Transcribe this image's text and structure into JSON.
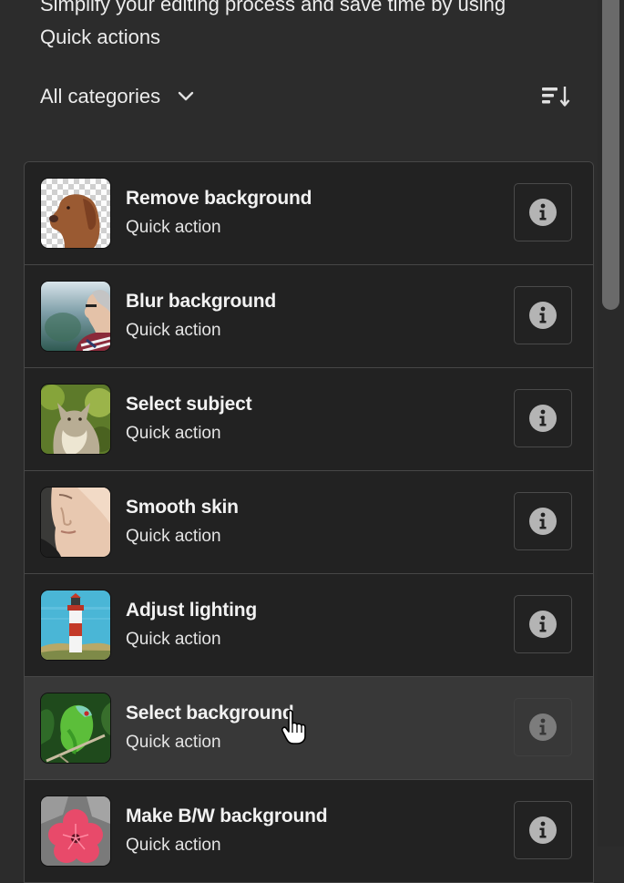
{
  "intro": {
    "line1": "Simplify your editing process and save time by using",
    "line2": "Quick actions"
  },
  "filter": {
    "category_label": "All categories",
    "chevron_icon": "chevron-down-icon",
    "sort_icon": "sort-descending-icon"
  },
  "actions": [
    {
      "title": "Remove background",
      "subtitle": "Quick action",
      "thumbnail": "dog-transparent-background",
      "info_icon": "info-icon"
    },
    {
      "title": "Blur background",
      "subtitle": "Quick action",
      "thumbnail": "woman-profile-blurred",
      "info_icon": "info-icon"
    },
    {
      "title": "Select subject",
      "subtitle": "Quick action",
      "thumbnail": "cat-in-grass",
      "info_icon": "info-icon"
    },
    {
      "title": "Smooth skin",
      "subtitle": "Quick action",
      "thumbnail": "young-man-face",
      "info_icon": "info-icon"
    },
    {
      "title": "Adjust lighting",
      "subtitle": "Quick action",
      "thumbnail": "lighthouse",
      "info_icon": "info-icon"
    },
    {
      "title": "Select background",
      "subtitle": "Quick action",
      "thumbnail": "green-parrot",
      "info_icon": "info-icon",
      "state": "hover"
    },
    {
      "title": "Make B/W background",
      "subtitle": "Quick action",
      "thumbnail": "pink-flower-bw",
      "info_icon": "info-icon"
    }
  ],
  "colors": {
    "background": "#2c2c2c",
    "row_background": "#222222",
    "row_hover": "#383838",
    "border": "#474747",
    "text": "#f2f2f2"
  }
}
